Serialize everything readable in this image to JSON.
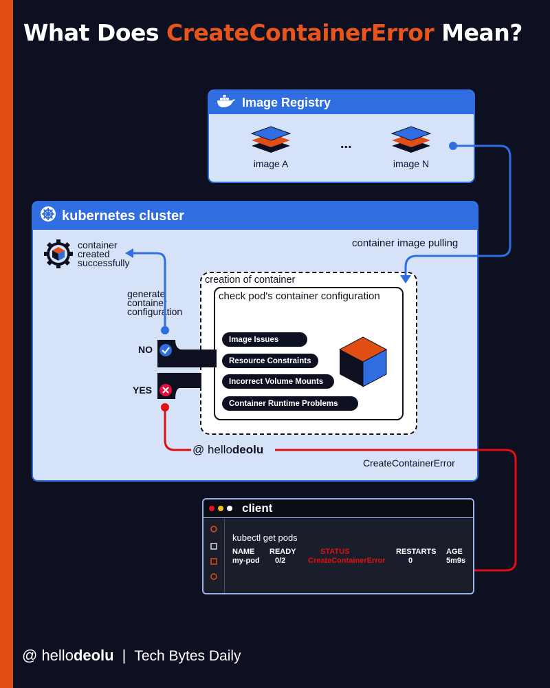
{
  "title": {
    "prefix": "What Does",
    "highlight": "CreateContainerError",
    "suffix": "Mean?"
  },
  "registry": {
    "title": "Image Registry",
    "images": [
      "image A",
      "image N"
    ],
    "ellipsis": "..."
  },
  "cluster": {
    "title": "kubernetes cluster"
  },
  "labels": {
    "image_pulling": "container image pulling",
    "creation": "creation of container",
    "check_config": "check pod's container configuration",
    "success_line1": "container",
    "success_line2": "created",
    "success_line3": "successfully",
    "generate_line1": "generate",
    "generate_line2": "container",
    "generate_line3": "configuration",
    "no": "NO",
    "yes": "YES",
    "error_edge": "CreateContainerError",
    "watermark_at": "@ hello",
    "watermark_bold": "deolu"
  },
  "issues": [
    "Image Issues",
    "Resource Constraints",
    "Incorrect Volume Mounts",
    "Container Runtime Problems"
  ],
  "client": {
    "title": "client",
    "command": "kubectl get pods",
    "headers": {
      "name": "NAME",
      "ready": "READY",
      "status": "STATUS",
      "restarts": "RESTARTS",
      "age": "AGE"
    },
    "row": {
      "name": "my-pod",
      "ready": "0/2",
      "status": "CreateContainerError",
      "restarts": "0",
      "age": "5m9s"
    }
  },
  "footer": {
    "at": "@ hello",
    "bold": "deolu",
    "sep": "|",
    "tagline": "Tech Bytes Daily"
  },
  "colors": {
    "accent": "#e8541c",
    "blue": "#2f6de0",
    "error": "#e01010",
    "background": "#0c1020"
  }
}
